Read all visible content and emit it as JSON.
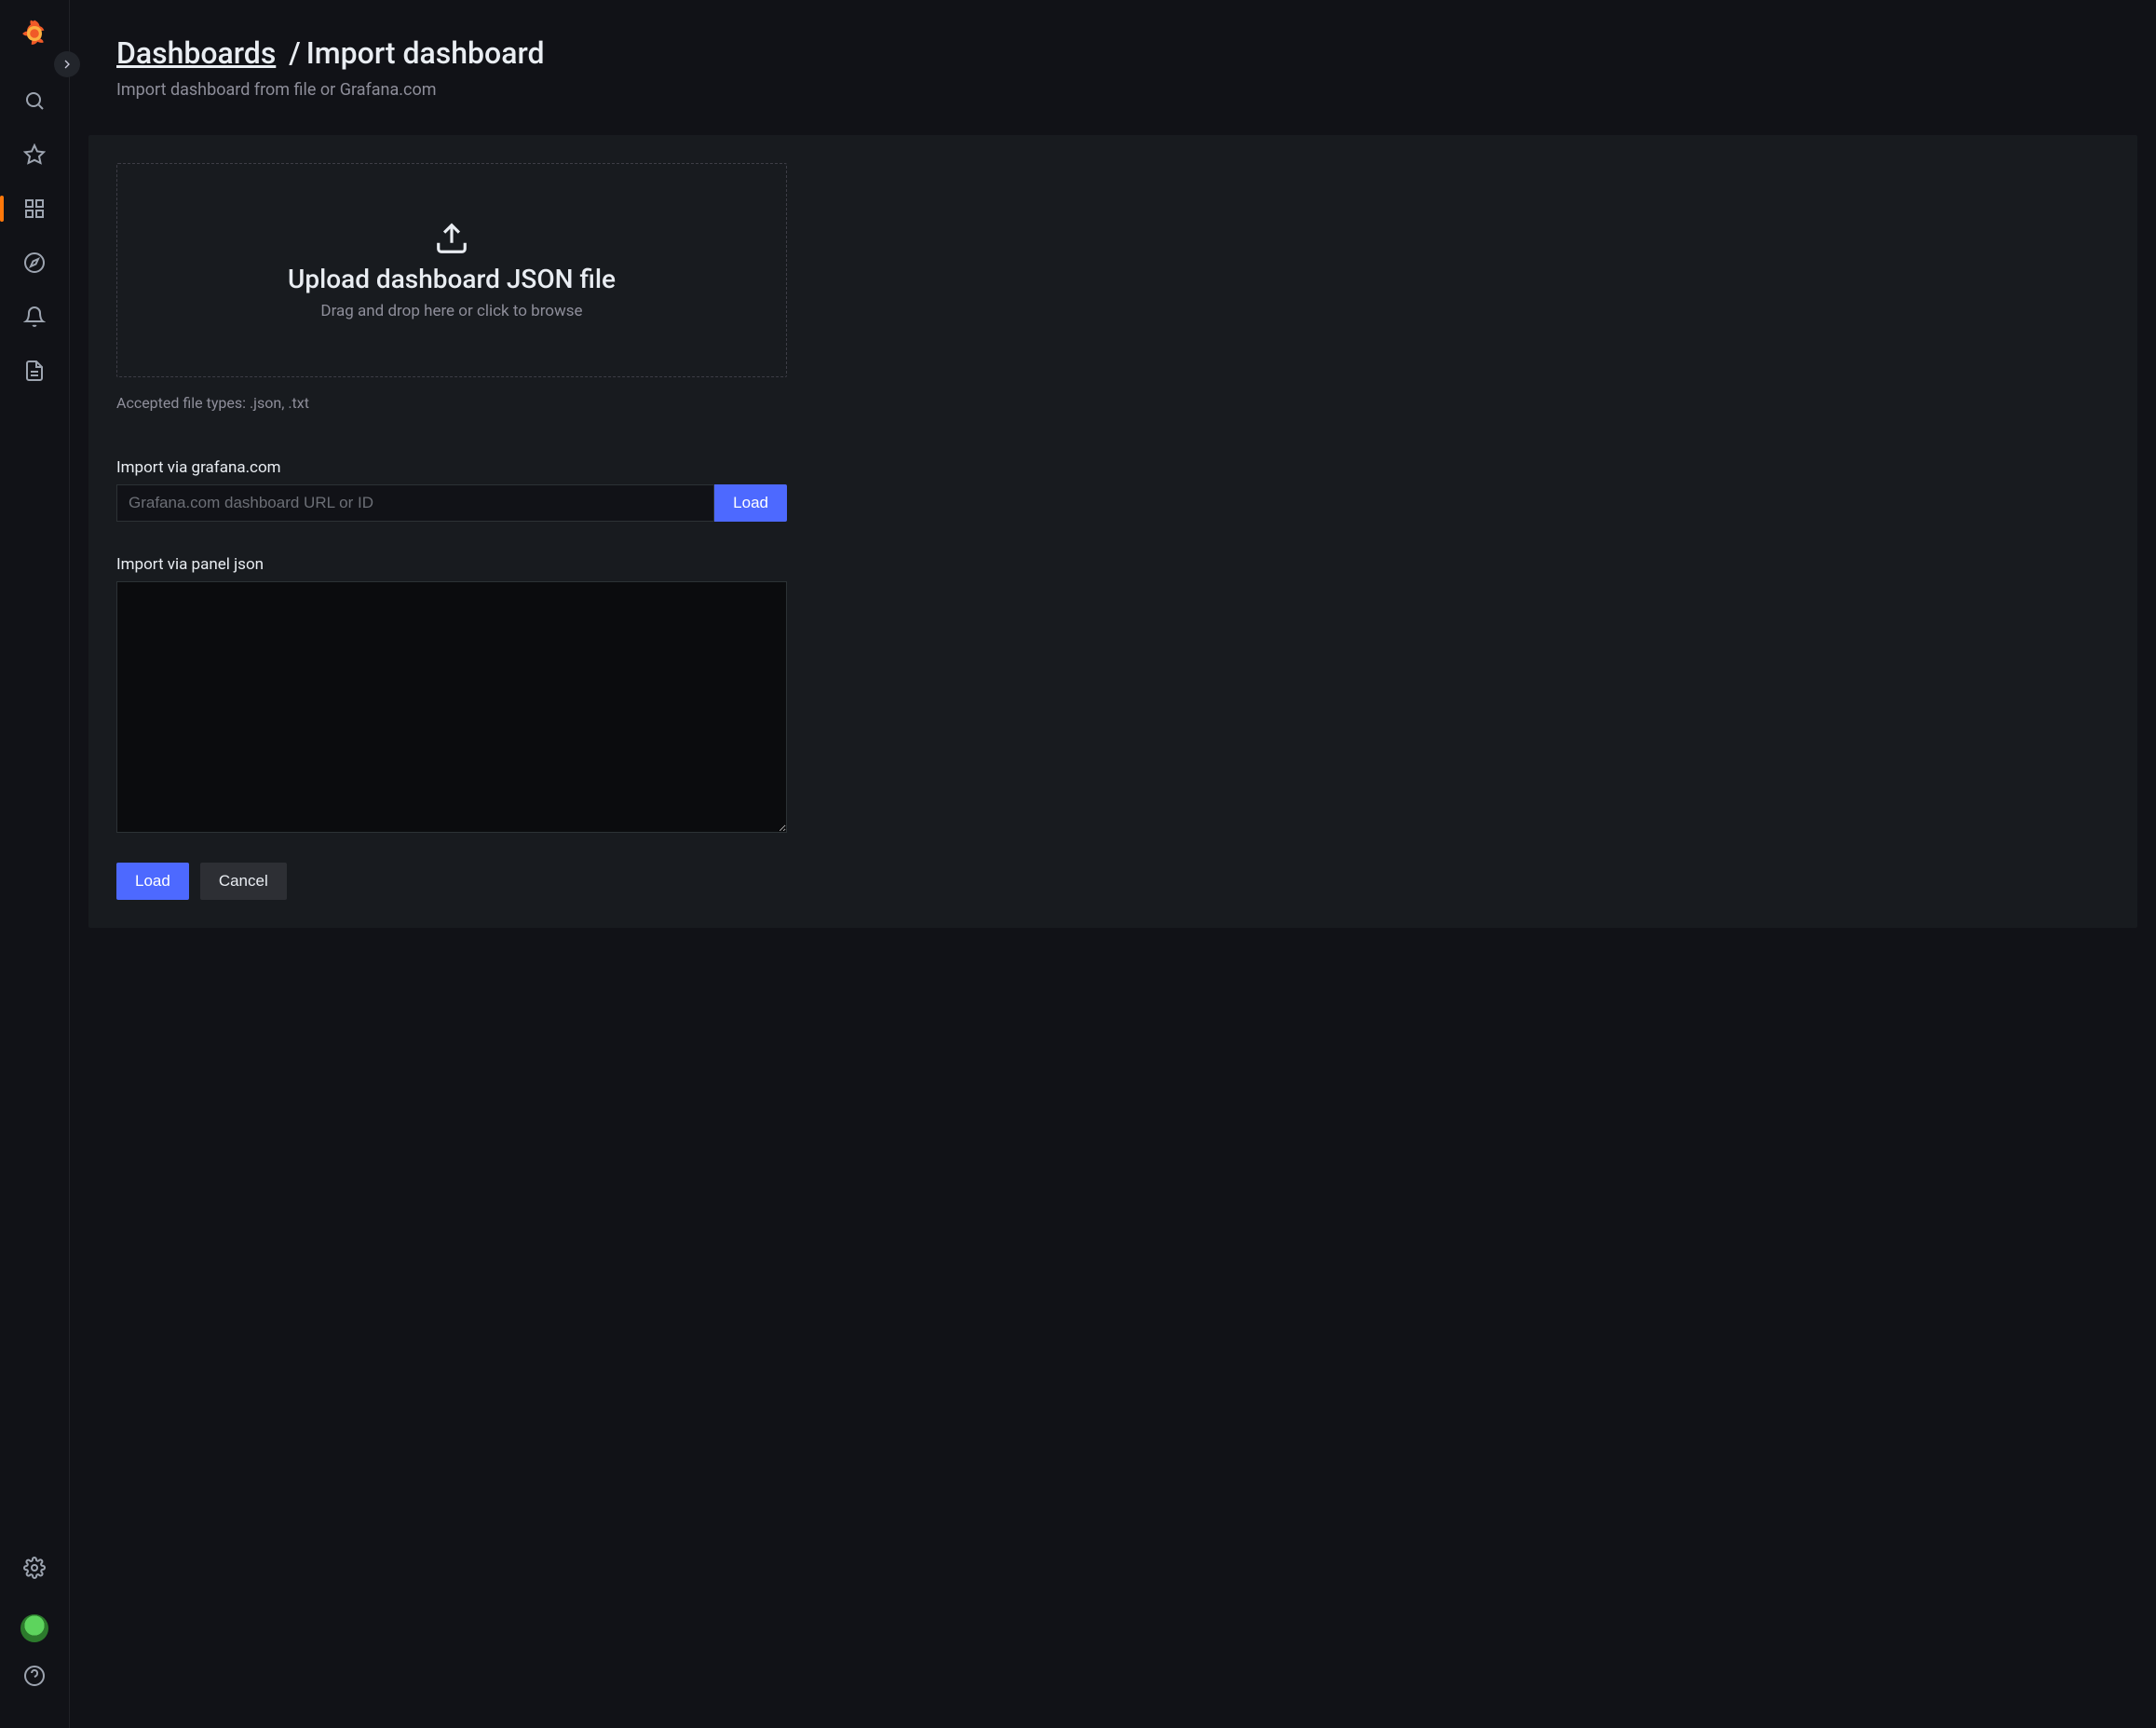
{
  "breadcrumb": {
    "root": "Dashboards",
    "separator": "/",
    "current": "Import dashboard"
  },
  "subtitle": "Import dashboard from file or Grafana.com",
  "dropzone": {
    "title": "Upload dashboard JSON file",
    "subtitle": "Drag and drop here or click to browse"
  },
  "helper_text": "Accepted file types: .json, .txt",
  "import_url": {
    "label": "Import via grafana.com",
    "placeholder": "Grafana.com dashboard URL or ID",
    "button": "Load"
  },
  "import_json": {
    "label": "Import via panel json"
  },
  "actions": {
    "primary": "Load",
    "secondary": "Cancel"
  },
  "sidebar": {
    "items": [
      {
        "name": "search-icon"
      },
      {
        "name": "star-icon"
      },
      {
        "name": "dashboards-icon",
        "active": true
      },
      {
        "name": "explore-icon"
      },
      {
        "name": "alerting-icon"
      },
      {
        "name": "admin-icon"
      }
    ]
  }
}
